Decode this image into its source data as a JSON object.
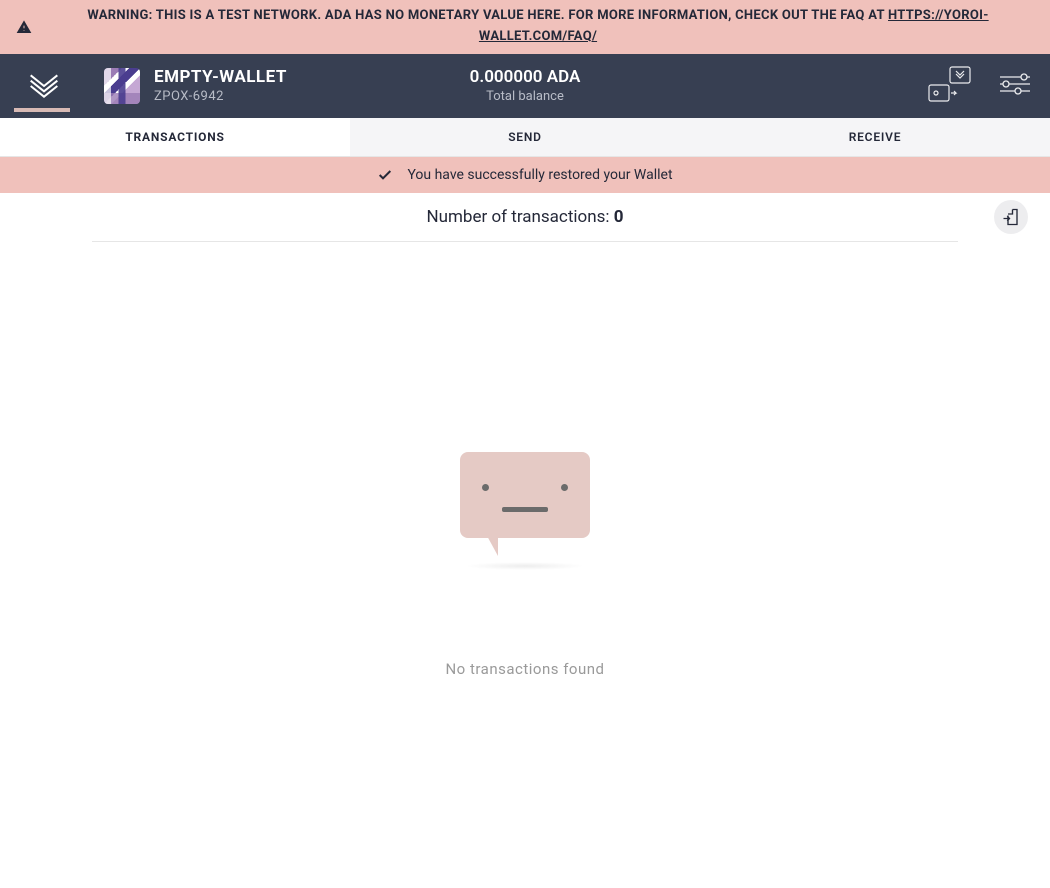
{
  "warning": {
    "text": "WARNING: THIS IS A TEST NETWORK. ADA HAS NO MONETARY VALUE HERE. FOR MORE INFORMATION, CHECK OUT THE FAQ AT ",
    "link_text": "HTTPS://YOROI-WALLET.COM/FAQ/"
  },
  "wallet": {
    "name": "EMPTY-WALLET",
    "id": "ZPOX-6942"
  },
  "balance": {
    "amount": "0.000000 ADA",
    "label": "Total balance"
  },
  "tabs": {
    "transactions": "TRANSACTIONS",
    "send": "SEND",
    "receive": "RECEIVE"
  },
  "notification": {
    "text": "You have successfully restored your Wallet"
  },
  "summary": {
    "label": "Number of transactions: ",
    "count": "0"
  },
  "empty": {
    "text": "No transactions found"
  }
}
